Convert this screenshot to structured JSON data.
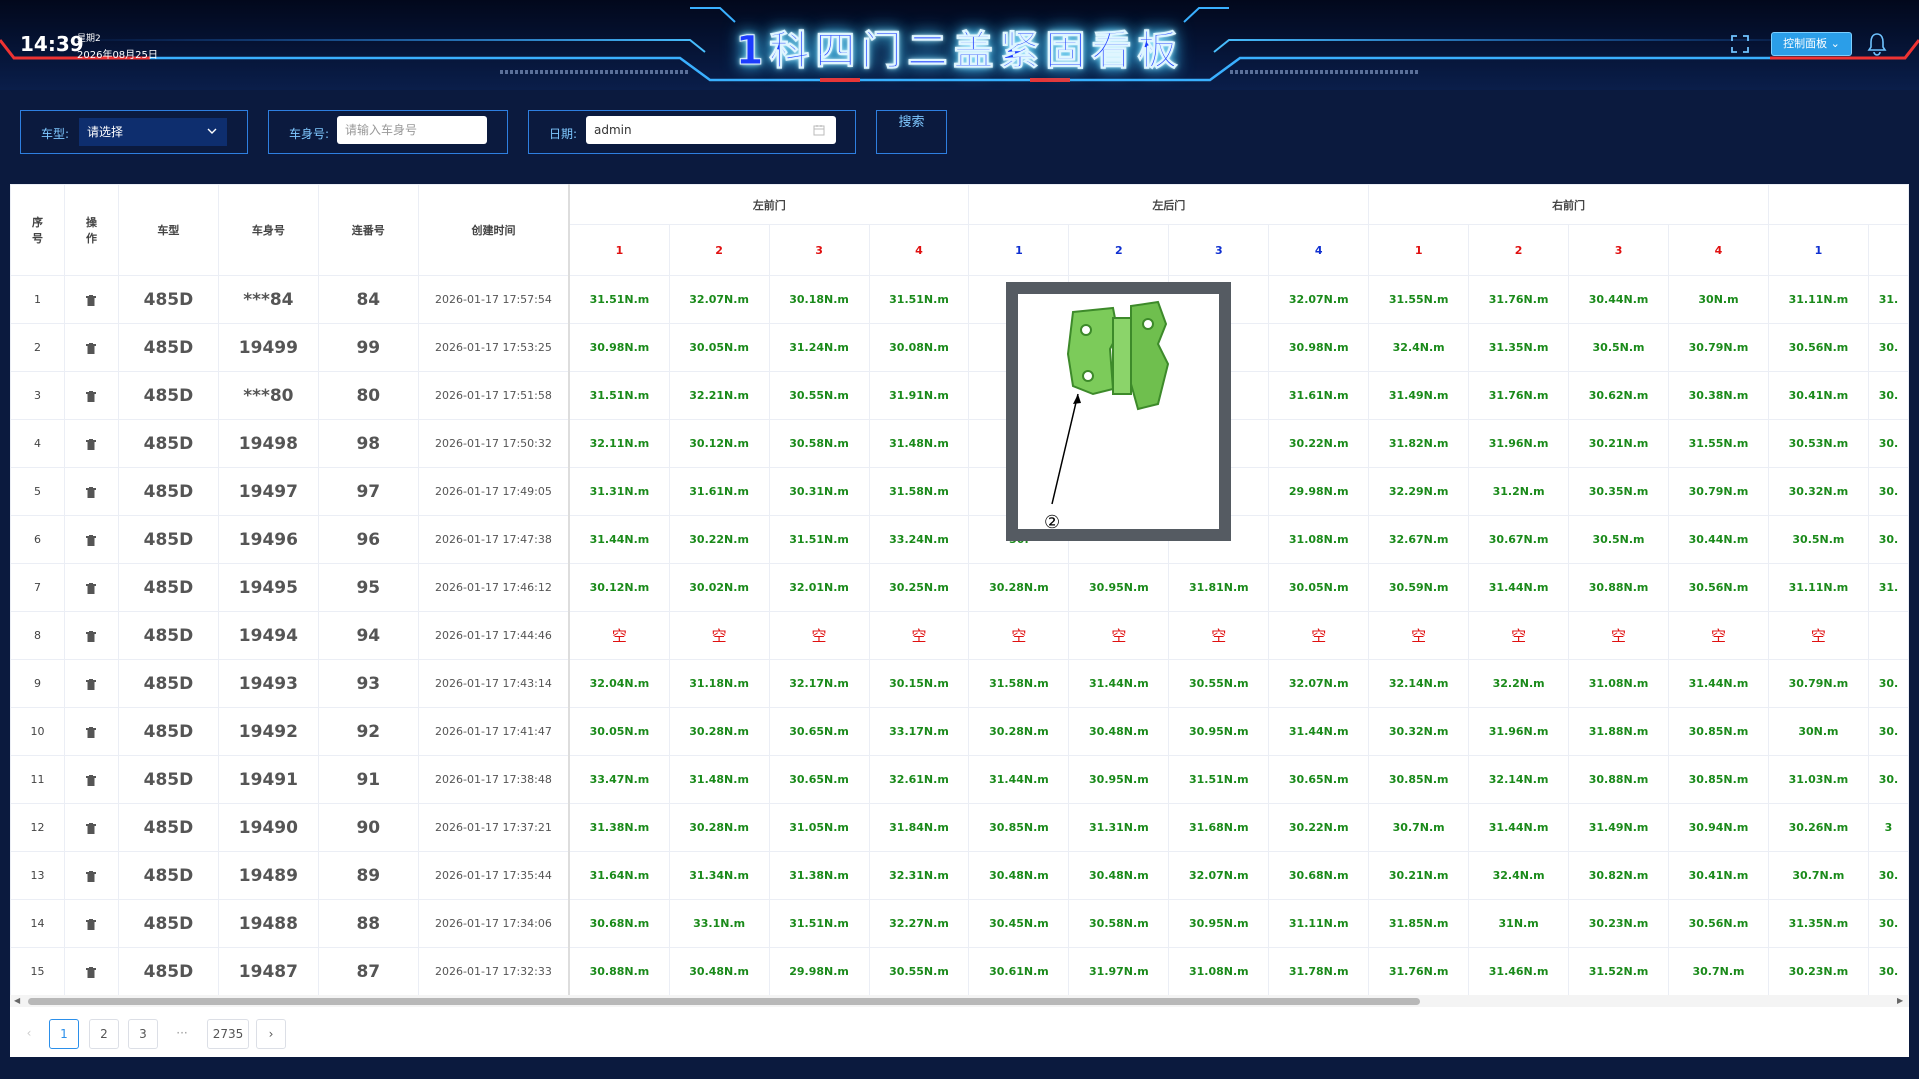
{
  "header": {
    "time": "14:39",
    "weekday": "星期2",
    "date": "2026年08月25日",
    "title": "1科四门二盖紧固看板",
    "control_panel": "控制面板"
  },
  "filters": {
    "car_type_label": "车型:",
    "car_type_value": "请选择",
    "body_no_label": "车身号:",
    "body_no_placeholder": "请输入车身号",
    "date_label": "日期:",
    "date_value": "admin",
    "search_label": "搜索"
  },
  "icons": [
    "print-icon",
    "hand-pointer-icon",
    "user-icon",
    "fullscreen-icon",
    "bell-icon",
    "calendar-icon",
    "trash-icon"
  ],
  "colors": {
    "bg": "#0b1a3e",
    "accent": "#2b9ee8",
    "value_green": "#1a8a1a",
    "point_red": "#e01010",
    "point_blue": "#1030d0"
  },
  "table": {
    "headers": {
      "idx": "序号",
      "op": "操作",
      "car_type": "车型",
      "body_no": "车身号",
      "serial": "连番号",
      "created": "创建时间"
    },
    "groups": [
      {
        "name": "左前门",
        "points": [
          "1",
          "2",
          "3",
          "4"
        ],
        "color": "red"
      },
      {
        "name": "左后门",
        "points": [
          "1",
          "2",
          "3",
          "4"
        ],
        "color": "blue"
      },
      {
        "name": "右前门",
        "points": [
          "1",
          "2",
          "3",
          "4"
        ],
        "color": "red"
      },
      {
        "name": "",
        "points": [
          "1"
        ],
        "color": "blue"
      }
    ],
    "rows": [
      {
        "idx": "1",
        "car": "485D",
        "body": "***84",
        "serial": "84",
        "time": "2026-01-17 17:57:54",
        "vals": [
          "31.51N.m",
          "32.07N.m",
          "30.18N.m",
          "31.51N.m",
          "29.",
          "",
          "",
          "32.07N.m",
          "31.55N.m",
          "31.76N.m",
          "30.44N.m",
          "30N.m",
          "31.11N.m",
          "31."
        ]
      },
      {
        "idx": "2",
        "car": "485D",
        "body": "19499",
        "serial": "99",
        "time": "2026-01-17 17:53:25",
        "vals": [
          "30.98N.m",
          "30.05N.m",
          "31.24N.m",
          "30.08N.m",
          "30.",
          "",
          "",
          "30.98N.m",
          "32.4N.m",
          "31.35N.m",
          "30.5N.m",
          "30.79N.m",
          "30.56N.m",
          "30."
        ]
      },
      {
        "idx": "3",
        "car": "485D",
        "body": "***80",
        "serial": "80",
        "time": "2026-01-17 17:51:58",
        "vals": [
          "31.51N.m",
          "32.21N.m",
          "30.55N.m",
          "31.91N.m",
          "31.",
          "",
          "",
          "31.61N.m",
          "31.49N.m",
          "31.76N.m",
          "30.62N.m",
          "30.38N.m",
          "30.41N.m",
          "30."
        ]
      },
      {
        "idx": "4",
        "car": "485D",
        "body": "19498",
        "serial": "98",
        "time": "2026-01-17 17:50:32",
        "vals": [
          "32.11N.m",
          "30.12N.m",
          "30.58N.m",
          "31.48N.m",
          "32.",
          "",
          "",
          "30.22N.m",
          "31.82N.m",
          "31.96N.m",
          "30.21N.m",
          "31.55N.m",
          "30.53N.m",
          "30."
        ]
      },
      {
        "idx": "5",
        "car": "485D",
        "body": "19497",
        "serial": "97",
        "time": "2026-01-17 17:49:05",
        "vals": [
          "31.31N.m",
          "31.61N.m",
          "30.31N.m",
          "31.58N.m",
          "31.",
          "",
          "",
          "29.98N.m",
          "32.29N.m",
          "31.2N.m",
          "30.35N.m",
          "30.79N.m",
          "30.32N.m",
          "30."
        ]
      },
      {
        "idx": "6",
        "car": "485D",
        "body": "19496",
        "serial": "96",
        "time": "2026-01-17 17:47:38",
        "vals": [
          "31.44N.m",
          "30.22N.m",
          "31.51N.m",
          "33.24N.m",
          "30.",
          "",
          "",
          "31.08N.m",
          "32.67N.m",
          "30.67N.m",
          "30.5N.m",
          "30.44N.m",
          "30.5N.m",
          "30."
        ]
      },
      {
        "idx": "7",
        "car": "485D",
        "body": "19495",
        "serial": "95",
        "time": "2026-01-17 17:46:12",
        "vals": [
          "30.12N.m",
          "30.02N.m",
          "32.01N.m",
          "30.25N.m",
          "30.28N.m",
          "30.95N.m",
          "31.81N.m",
          "30.05N.m",
          "30.59N.m",
          "31.44N.m",
          "30.88N.m",
          "30.56N.m",
          "31.11N.m",
          "31."
        ]
      },
      {
        "idx": "8",
        "car": "485D",
        "body": "19494",
        "serial": "94",
        "time": "2026-01-17 17:44:46",
        "vals": [
          "空",
          "空",
          "空",
          "空",
          "空",
          "空",
          "空",
          "空",
          "空",
          "空",
          "空",
          "空",
          "空",
          ""
        ]
      },
      {
        "idx": "9",
        "car": "485D",
        "body": "19493",
        "serial": "93",
        "time": "2026-01-17 17:43:14",
        "vals": [
          "32.04N.m",
          "31.18N.m",
          "32.17N.m",
          "30.15N.m",
          "31.58N.m",
          "31.44N.m",
          "30.55N.m",
          "32.07N.m",
          "32.14N.m",
          "32.2N.m",
          "31.08N.m",
          "31.44N.m",
          "30.79N.m",
          "30."
        ]
      },
      {
        "idx": "10",
        "car": "485D",
        "body": "19492",
        "serial": "92",
        "time": "2026-01-17 17:41:47",
        "vals": [
          "30.05N.m",
          "30.28N.m",
          "30.65N.m",
          "33.17N.m",
          "30.28N.m",
          "30.48N.m",
          "30.95N.m",
          "31.44N.m",
          "30.32N.m",
          "31.96N.m",
          "31.88N.m",
          "30.85N.m",
          "30N.m",
          "30."
        ]
      },
      {
        "idx": "11",
        "car": "485D",
        "body": "19491",
        "serial": "91",
        "time": "2026-01-17 17:38:48",
        "vals": [
          "33.47N.m",
          "31.48N.m",
          "30.65N.m",
          "32.61N.m",
          "31.44N.m",
          "30.95N.m",
          "31.51N.m",
          "30.65N.m",
          "30.85N.m",
          "32.14N.m",
          "30.88N.m",
          "30.85N.m",
          "31.03N.m",
          "30."
        ]
      },
      {
        "idx": "12",
        "car": "485D",
        "body": "19490",
        "serial": "90",
        "time": "2026-01-17 17:37:21",
        "vals": [
          "31.38N.m",
          "30.28N.m",
          "31.05N.m",
          "31.84N.m",
          "30.85N.m",
          "31.31N.m",
          "31.68N.m",
          "30.22N.m",
          "30.7N.m",
          "31.44N.m",
          "31.49N.m",
          "30.94N.m",
          "30.26N.m",
          "3"
        ]
      },
      {
        "idx": "13",
        "car": "485D",
        "body": "19489",
        "serial": "89",
        "time": "2026-01-17 17:35:44",
        "vals": [
          "31.64N.m",
          "31.34N.m",
          "31.38N.m",
          "32.31N.m",
          "30.48N.m",
          "30.48N.m",
          "32.07N.m",
          "30.68N.m",
          "30.21N.m",
          "32.4N.m",
          "30.82N.m",
          "30.41N.m",
          "30.7N.m",
          "30."
        ]
      },
      {
        "idx": "14",
        "car": "485D",
        "body": "19488",
        "serial": "88",
        "time": "2026-01-17 17:34:06",
        "vals": [
          "30.68N.m",
          "33.1N.m",
          "31.51N.m",
          "32.27N.m",
          "30.45N.m",
          "30.58N.m",
          "30.95N.m",
          "31.11N.m",
          "31.85N.m",
          "31N.m",
          "30.23N.m",
          "30.56N.m",
          "31.35N.m",
          "30."
        ]
      },
      {
        "idx": "15",
        "car": "485D",
        "body": "19487",
        "serial": "87",
        "time": "2026-01-17 17:32:33",
        "vals": [
          "30.88N.m",
          "30.48N.m",
          "29.98N.m",
          "30.55N.m",
          "30.61N.m",
          "31.97N.m",
          "31.08N.m",
          "31.78N.m",
          "31.76N.m",
          "31.46N.m",
          "31.52N.m",
          "30.7N.m",
          "30.23N.m",
          "30."
        ]
      }
    ]
  },
  "pagination": {
    "pages": [
      "1",
      "2",
      "3"
    ],
    "ellipsis": "···",
    "last": "2735",
    "current": "1"
  },
  "popup": {
    "marker": "②"
  }
}
